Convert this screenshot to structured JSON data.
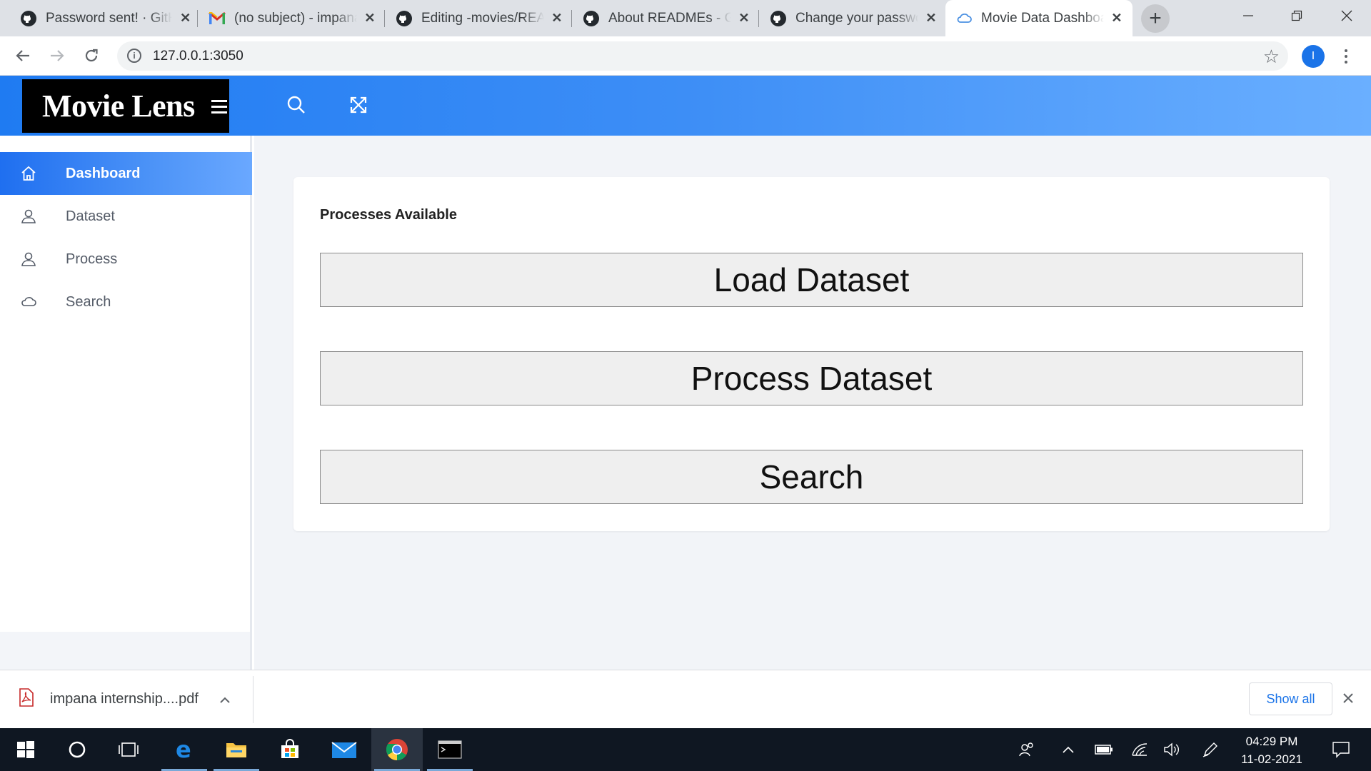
{
  "browser": {
    "tabs": [
      {
        "title": "Password sent! · GitHub",
        "favicon": "github-icon"
      },
      {
        "title": "(no subject) - impana",
        "favicon": "gmail-icon"
      },
      {
        "title": "Editing -movies/README",
        "favicon": "github-icon"
      },
      {
        "title": "About READMEs - GitHub",
        "favicon": "github-icon"
      },
      {
        "title": "Change your password",
        "favicon": "github-icon"
      },
      {
        "title": "Movie Data Dashboard",
        "favicon": "page-icon",
        "active": true
      }
    ],
    "new_tab_label": "+",
    "address": "127.0.0.1:3050",
    "profile_initial": "I"
  },
  "app": {
    "brand": "Movie Lens",
    "accent": "#2f86f4",
    "sidebar": {
      "items": [
        {
          "label": "Dashboard",
          "icon": "home-icon",
          "active": true
        },
        {
          "label": "Dataset",
          "icon": "user-icon"
        },
        {
          "label": "Process",
          "icon": "user-icon"
        },
        {
          "label": "Search",
          "icon": "cloud-icon"
        }
      ]
    },
    "card": {
      "title": "Processes Available",
      "buttons": [
        "Load Dataset",
        "Process Dataset",
        "Search"
      ]
    }
  },
  "download_shelf": {
    "file_name": "impana internship....pdf",
    "file_icon": "pdf-icon",
    "show_all": "Show all"
  },
  "taskbar": {
    "time": "04:29 PM",
    "date": "11-02-2021"
  }
}
